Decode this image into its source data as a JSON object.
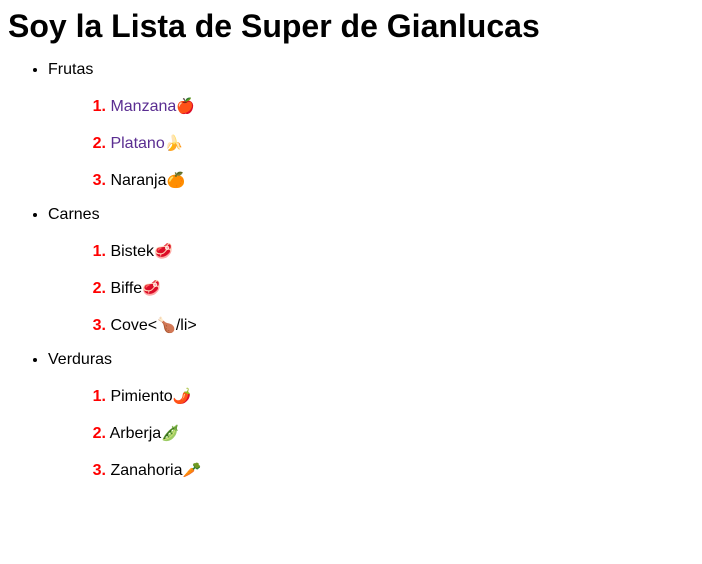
{
  "title": "Soy la Lista de Super de Gianlucas",
  "colors": {
    "marker": "#ff0000",
    "visited_link": "#5a2d91",
    "text": "#000000"
  },
  "categories": [
    {
      "label": "Frutas",
      "items": [
        {
          "num": "1.",
          "label": "Manzana",
          "emoji": "🍎",
          "visited": true
        },
        {
          "num": "2.",
          "label": "Platano",
          "emoji": "🍌",
          "visited": true
        },
        {
          "num": "3.",
          "label": "Naranja",
          "emoji": "🍊",
          "visited": false
        }
      ]
    },
    {
      "label": "Carnes",
      "items": [
        {
          "num": "1.",
          "label": "Bistek",
          "emoji": "🥩",
          "visited": false
        },
        {
          "num": "2.",
          "label": "Biffe",
          "emoji": "🥩",
          "visited": false
        },
        {
          "num": "3.",
          "label": "Cove<",
          "emoji": "🍗",
          "suffix": "/li>",
          "visited": false
        }
      ]
    },
    {
      "label": "Verduras",
      "items": [
        {
          "num": "1.",
          "label": "Pimiento",
          "emoji": "🌶️",
          "visited": false
        },
        {
          "num": "2.",
          "label": "Arberja",
          "emoji": "🫛",
          "visited": false
        },
        {
          "num": "3.",
          "label": "Zanahoria",
          "emoji": "🥕",
          "visited": false
        }
      ]
    }
  ]
}
